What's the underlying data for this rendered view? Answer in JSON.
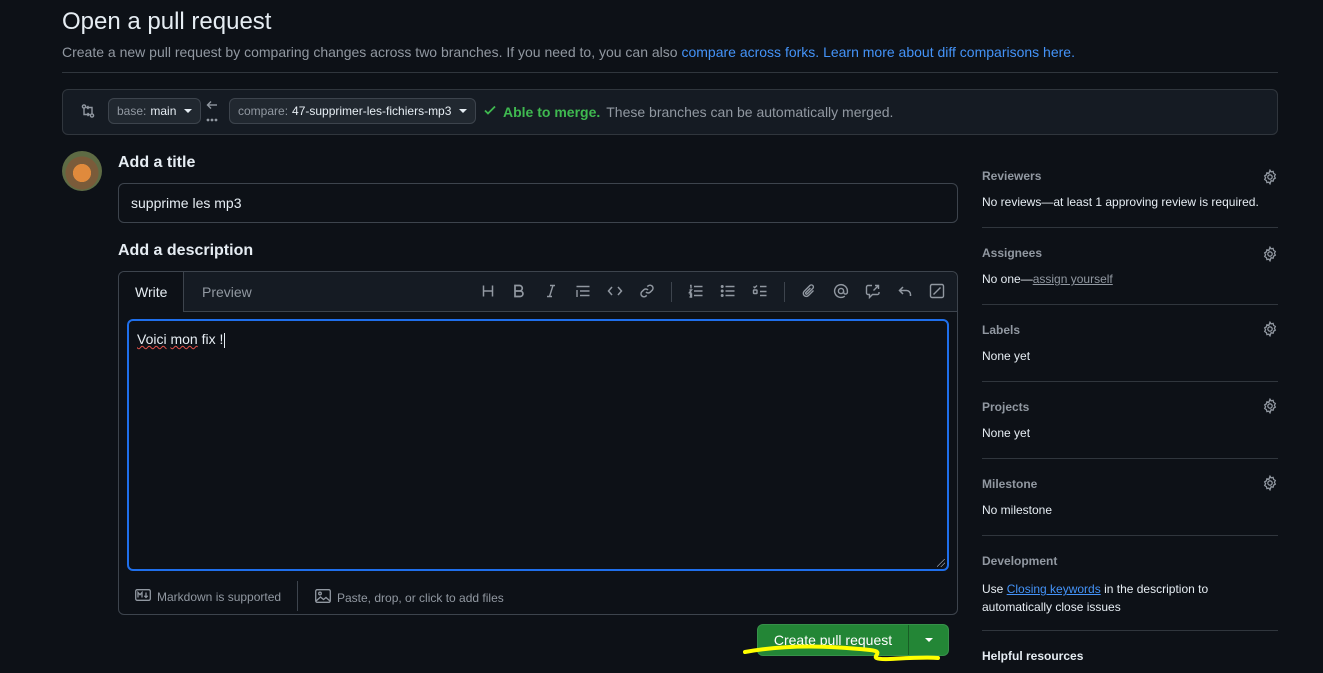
{
  "header": {
    "title": "Open a pull request",
    "subtitle_text": "Create a new pull request by comparing changes across two branches. If you need to, you can also ",
    "compare_forks_link": "compare across forks.",
    "learn_more_link": "Learn more about diff comparisons here."
  },
  "range": {
    "base_prefix": "base:",
    "base_branch": "main",
    "compare_prefix": "compare:",
    "compare_branch": "47-supprimer-les-fichiers-mp3",
    "merge_ok": "Able to merge.",
    "merge_text": "These branches can be automatically merged."
  },
  "form": {
    "title_label": "Add a title",
    "title_value": "supprime les mp3",
    "description_label": "Add a description",
    "tab_write": "Write",
    "tab_preview": "Preview",
    "body_word1": "Voici",
    "body_word2": "mon",
    "body_rest": " fix !",
    "markdown_note": "Markdown is supported",
    "files_note": "Paste, drop, or click to add files",
    "submit_label": "Create pull request"
  },
  "sidebar": {
    "reviewers": {
      "title": "Reviewers",
      "value": "No reviews—at least 1 approving review is required."
    },
    "assignees": {
      "title": "Assignees",
      "value": "No one—",
      "link": "assign yourself"
    },
    "labels": {
      "title": "Labels",
      "value": "None yet"
    },
    "projects": {
      "title": "Projects",
      "value": "None yet"
    },
    "milestone": {
      "title": "Milestone",
      "value": "No milestone"
    },
    "development": {
      "title": "Development",
      "pre": "Use ",
      "link": "Closing keywords",
      "post": " in the description to",
      "line2": "automatically close issues"
    },
    "helpful": {
      "title": "Helpful resources"
    }
  },
  "colors": {
    "accent": "#4493f8",
    "success": "#3fb950",
    "button_green": "#238636",
    "highlight": "#ffff00"
  }
}
